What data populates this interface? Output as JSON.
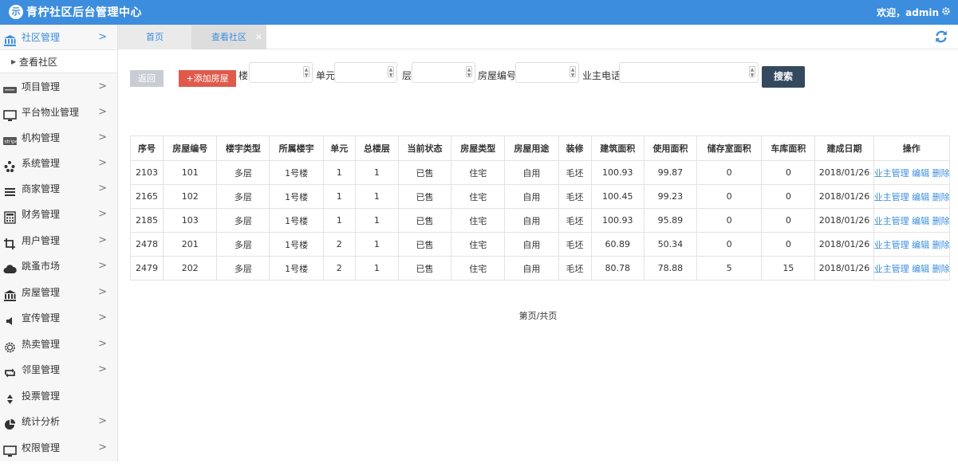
{
  "header": {
    "brand": "青柠社区后台管理中心",
    "logo_char": "示",
    "welcome": "欢迎，admin"
  },
  "sidebar": {
    "items": [
      {
        "label": "社区管理",
        "icon": "bank-icon",
        "active": true
      },
      {
        "label": "项目管理",
        "icon": "card-icon"
      },
      {
        "label": "平台物业管理",
        "icon": "monitor-icon"
      },
      {
        "label": "机构管理",
        "icon": "stripe-icon"
      },
      {
        "label": "系统管理",
        "icon": "yelp-icon"
      },
      {
        "label": "商家管理",
        "icon": "list-icon"
      },
      {
        "label": "财务管理",
        "icon": "calculator-icon"
      },
      {
        "label": "用户管理",
        "icon": "crop-icon"
      },
      {
        "label": "跳蚤市场",
        "icon": "cloud-icon"
      },
      {
        "label": "房屋管理",
        "icon": "bank-icon"
      },
      {
        "label": "宣传管理",
        "icon": "volume-icon"
      },
      {
        "label": "热卖管理",
        "icon": "sun-icon"
      },
      {
        "label": "邻里管理",
        "icon": "retweet-icon"
      },
      {
        "label": "投票管理",
        "icon": "sort-icon"
      },
      {
        "label": "统计分析",
        "icon": "pie-chart-icon"
      },
      {
        "label": "权限管理",
        "icon": "desktop-icon"
      }
    ],
    "sub_item": "查看社区"
  },
  "tabs": [
    {
      "label": "首页"
    },
    {
      "label": "查看社区"
    }
  ],
  "toolbar": {
    "back_label": "返回",
    "add_label": "+添加房屋",
    "filter_building": "楼",
    "filter_unit": "单元",
    "filter_floor": "层",
    "filter_house_no": "房屋编号",
    "filter_phone": "业主电话",
    "search_label": "搜索"
  },
  "table": {
    "headers": [
      "序号",
      "房屋编号",
      "楼宇类型",
      "所属楼宇",
      "单元",
      "总楼层",
      "当前状态",
      "房屋类型",
      "房屋用途",
      "装修",
      "建筑面积",
      "使用面积",
      "储存室面积",
      "车库面积",
      "建成日期",
      "操作"
    ],
    "rows": [
      [
        "2103",
        "101",
        "多层",
        "1号楼",
        "1",
        "1",
        "已售",
        "住宅",
        "自用",
        "毛坯",
        "100.93",
        "99.87",
        "0",
        "0",
        "2018/01/26"
      ],
      [
        "2165",
        "102",
        "多层",
        "1号楼",
        "1",
        "1",
        "已售",
        "住宅",
        "自用",
        "毛坯",
        "100.45",
        "99.23",
        "0",
        "0",
        "2018/01/26"
      ],
      [
        "2185",
        "103",
        "多层",
        "1号楼",
        "1",
        "1",
        "已售",
        "住宅",
        "自用",
        "毛坯",
        "100.93",
        "95.89",
        "0",
        "0",
        "2018/01/26"
      ],
      [
        "2478",
        "201",
        "多层",
        "1号楼",
        "2",
        "1",
        "已售",
        "住宅",
        "自用",
        "毛坯",
        "60.89",
        "50.34",
        "0",
        "0",
        "2018/01/26"
      ],
      [
        "2479",
        "202",
        "多层",
        "1号楼",
        "2",
        "1",
        "已售",
        "住宅",
        "自用",
        "毛坯",
        "80.78",
        "78.88",
        "5",
        "15",
        "2018/01/26"
      ]
    ],
    "ops": [
      "业主管理",
      "编辑",
      "删除"
    ]
  },
  "pager": "第页/共页",
  "colors": {
    "primary": "#3c8dde",
    "danger": "#e05a4b",
    "dark": "#34495e"
  }
}
